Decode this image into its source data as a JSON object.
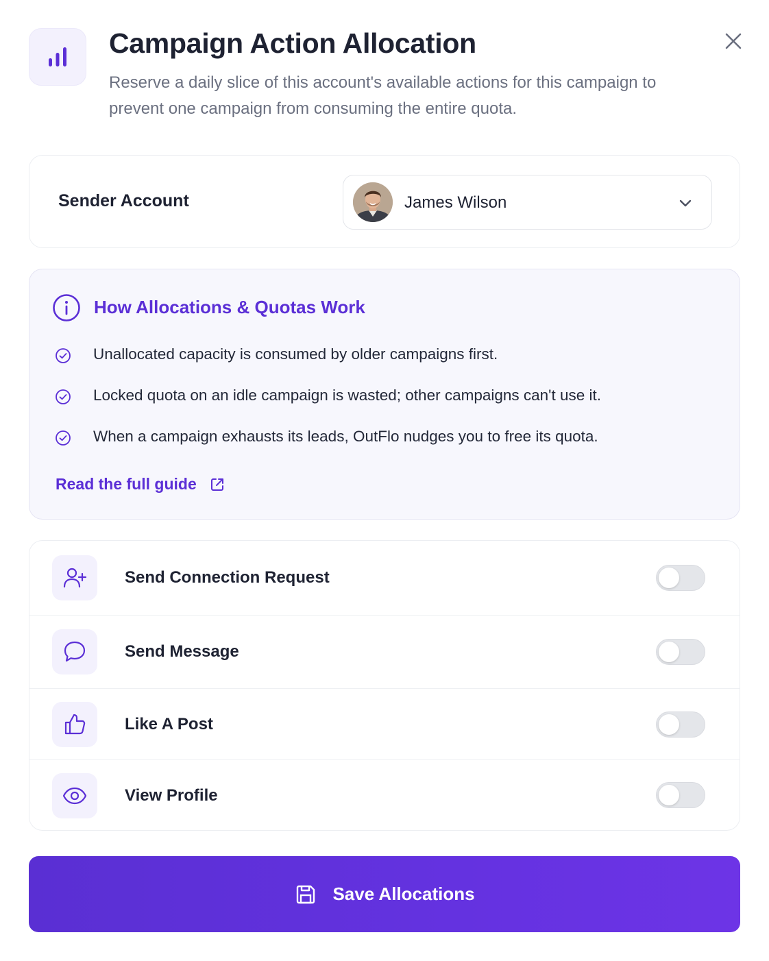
{
  "header": {
    "icon": "bar-chart-icon",
    "title": "Campaign Action Allocation",
    "subtitle": "Reserve a daily slice of this account's available actions for this campaign to prevent one campaign from consuming the entire quota.",
    "close_icon": "close-icon"
  },
  "sender": {
    "label": "Sender Account",
    "selected_account": "James Wilson",
    "avatar": "user-avatar",
    "chevron_icon": "chevron-down-icon"
  },
  "info": {
    "title": "How Allocations & Quotas Work",
    "items": [
      "Unallocated capacity is consumed by older campaigns first.",
      "Locked quota on an idle campaign is wasted; other campaigns can't use it.",
      "When a campaign exhausts its leads, OutFlo nudges you to free its quota."
    ],
    "link_label": "Read the full guide"
  },
  "actions": [
    {
      "label": "Send Connection Request",
      "icon": "user-plus-icon",
      "enabled": false
    },
    {
      "label": "Send Message",
      "icon": "message-bubble-icon",
      "enabled": false
    },
    {
      "label": "Like A Post",
      "icon": "thumbs-up-icon",
      "enabled": false
    },
    {
      "label": "View Profile",
      "icon": "eye-icon",
      "enabled": false
    }
  ],
  "save": {
    "label": "Save Allocations",
    "icon": "save-icon"
  },
  "colors": {
    "accent": "#5b2fd6",
    "icon_bg": "#f3f1fd",
    "toggle_off": "#e4e6ea",
    "button_gradient_start": "#5a2fd3",
    "button_gradient_end": "#6d34e6"
  }
}
